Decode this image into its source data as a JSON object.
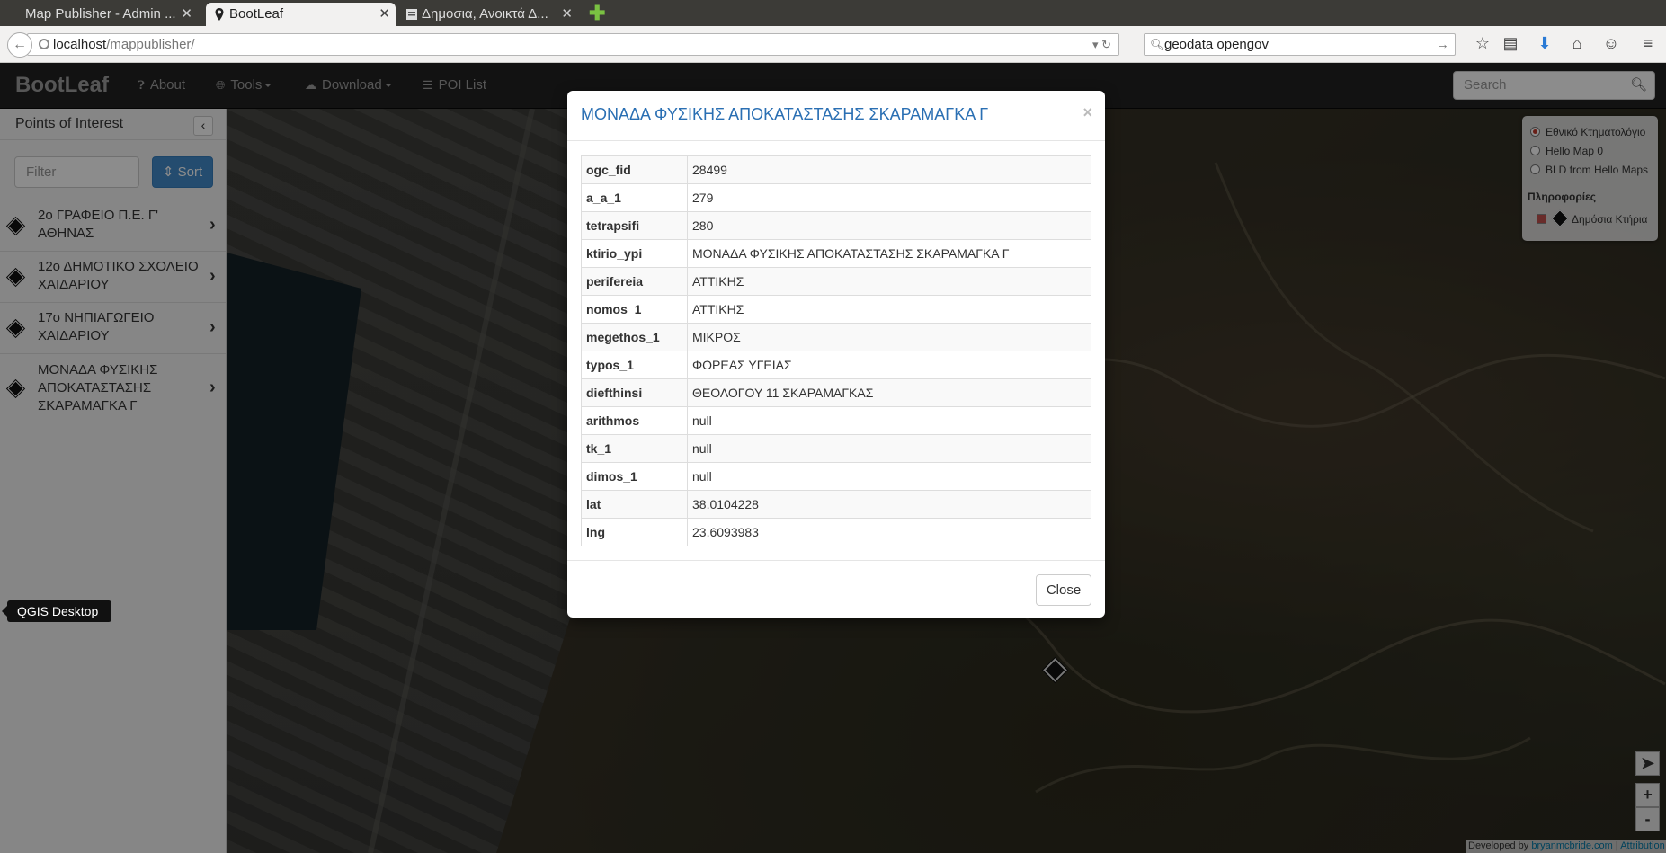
{
  "browser": {
    "tabs": [
      {
        "title": "Map Publisher - Admin ...",
        "active": false
      },
      {
        "title": "BootLeaf",
        "active": true
      },
      {
        "title": "Δημοσια, Ανοικτά Δ...",
        "active": false
      }
    ],
    "url_host": "localhost",
    "url_path": "/mappublisher/",
    "search_value": "geodata opengov"
  },
  "app": {
    "brand": "BootLeaf",
    "nav": {
      "about": "About",
      "tools": "Tools",
      "download": "Download",
      "poi_list": "POI List"
    },
    "search_placeholder": "Search"
  },
  "sidebar": {
    "title": "Points of Interest",
    "filter_placeholder": "Filter",
    "sort_label": "Sort",
    "items": [
      {
        "label": "2ο ΓΡΑΦΕΙΟ Π.Ε. Γ' ΑΘΗΝΑΣ"
      },
      {
        "label": "12ο ΔΗΜΟΤΙΚΟ ΣΧΟΛΕΙΟ ΧΑΙΔΑΡΙΟΥ"
      },
      {
        "label": "17ο ΝΗΠΙΑΓΩΓΕΙΟ ΧΑΙΔΑΡΙΟΥ"
      },
      {
        "label": "ΜΟΝΑΔΑ ΦΥΣΙΚΗΣ ΑΠΟΚΑΤΑΣΤΑΣΗΣ ΣΚΑΡΑΜΑΓΚΑ Γ"
      }
    ],
    "tooltip": "QGIS Desktop"
  },
  "layers": {
    "base": [
      {
        "label": "Εθνικό Κτηματολόγιο",
        "selected": true
      },
      {
        "label": "Hello Map 0",
        "selected": false
      },
      {
        "label": "BLD from Hello Maps",
        "selected": false
      }
    ],
    "overlay_title": "Πληροφορίες",
    "overlay_label": "Δημόσια Κτήρια"
  },
  "map_controls": {
    "zoom_in": "+",
    "zoom_out": "-"
  },
  "attribution": {
    "prefix": "Developed by ",
    "link": "bryanmcbride.com",
    "sep": " | ",
    "attr": "Attribution"
  },
  "modal": {
    "title": "ΜΟΝΑΔΑ ΦΥΣΙΚΗΣ ΑΠΟΚΑΤΑΣΤΑΣΗΣ ΣΚΑΡΑΜΑΓΚΑ Γ",
    "close_x": "×",
    "rows": [
      {
        "key": "ogc_fid",
        "value": "28499"
      },
      {
        "key": "a_a_1",
        "value": "279"
      },
      {
        "key": "tetrapsifi",
        "value": "280"
      },
      {
        "key": "ktirio_ypi",
        "value": "ΜΟΝΑΔΑ ΦΥΣΙΚΗΣ ΑΠΟΚΑΤΑΣΤΑΣΗΣ ΣΚΑΡΑΜΑΓΚΑ Γ"
      },
      {
        "key": "perifereia",
        "value": "ΑΤΤΙΚΗΣ"
      },
      {
        "key": "nomos_1",
        "value": "ΑΤΤΙΚΗΣ"
      },
      {
        "key": "megethos_1",
        "value": "ΜΙΚΡΟΣ"
      },
      {
        "key": "typos_1",
        "value": "ΦΟΡΕΑΣ ΥΓΕΙΑΣ"
      },
      {
        "key": "diefthinsi",
        "value": "ΘΕΟΛΟΓΟΥ 11 ΣΚΑΡΑΜΑΓΚΑΣ"
      },
      {
        "key": "arithmos",
        "value": "null"
      },
      {
        "key": "tk_1",
        "value": "null"
      },
      {
        "key": "dimos_1",
        "value": "null"
      },
      {
        "key": "lat",
        "value": "38.0104228"
      },
      {
        "key": "lng",
        "value": "23.6093983"
      }
    ],
    "close_label": "Close"
  }
}
